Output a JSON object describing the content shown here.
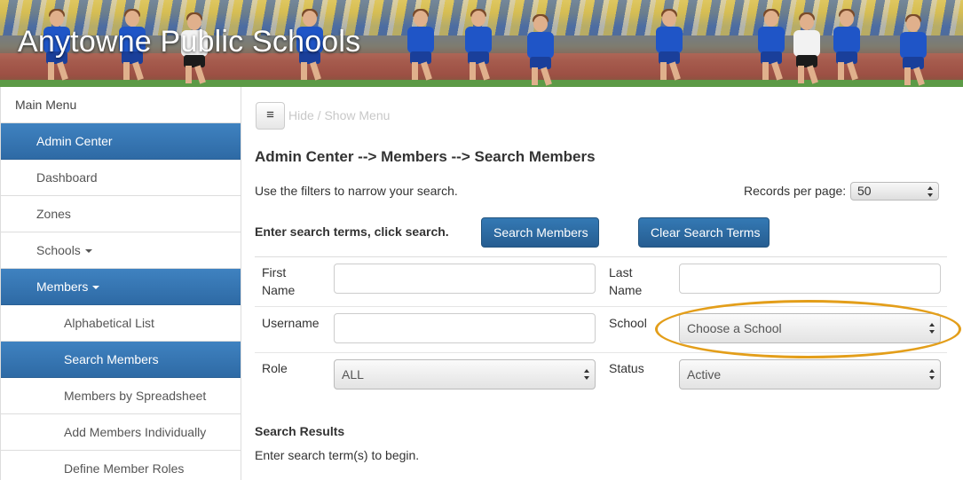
{
  "header": {
    "title": "Anytowne Public Schools"
  },
  "sidebar": {
    "items": [
      {
        "label": "Main Menu"
      },
      {
        "label": "Admin Center"
      },
      {
        "label": "Dashboard"
      },
      {
        "label": "Zones"
      },
      {
        "label": "Schools"
      },
      {
        "label": "Members"
      },
      {
        "label": "Alphabetical List"
      },
      {
        "label": "Search Members"
      },
      {
        "label": "Members by Spreadsheet"
      },
      {
        "label": "Add Members Individually"
      },
      {
        "label": "Define Member Roles"
      }
    ]
  },
  "toolbar": {
    "toggle_icon": "≡",
    "toggle_label": "Hide / Show Menu"
  },
  "page": {
    "title": "Admin Center --> Members --> Search Members",
    "help": "Use the filters to narrow your search.",
    "records_label": "Records per page:",
    "records_value": "50"
  },
  "search": {
    "prompt": "Enter search terms, click search.",
    "search_button": "Search Members",
    "clear_button": "Clear Search Terms"
  },
  "filters": {
    "first_name_label_1": "First",
    "first_name_label_2": "Name",
    "first_name_value": "",
    "last_name_label_1": "Last",
    "last_name_label_2": "Name",
    "last_name_value": "",
    "username_label": "Username",
    "username_value": "",
    "school_label": "School",
    "school_value": "Choose a School",
    "role_label": "Role",
    "role_value": "ALL",
    "status_label": "Status",
    "status_value": "Active"
  },
  "results": {
    "title": "Search Results",
    "message": "Enter search term(s) to begin."
  },
  "colors": {
    "accent": "#2e6aa5",
    "highlight": "#e39e1a"
  }
}
